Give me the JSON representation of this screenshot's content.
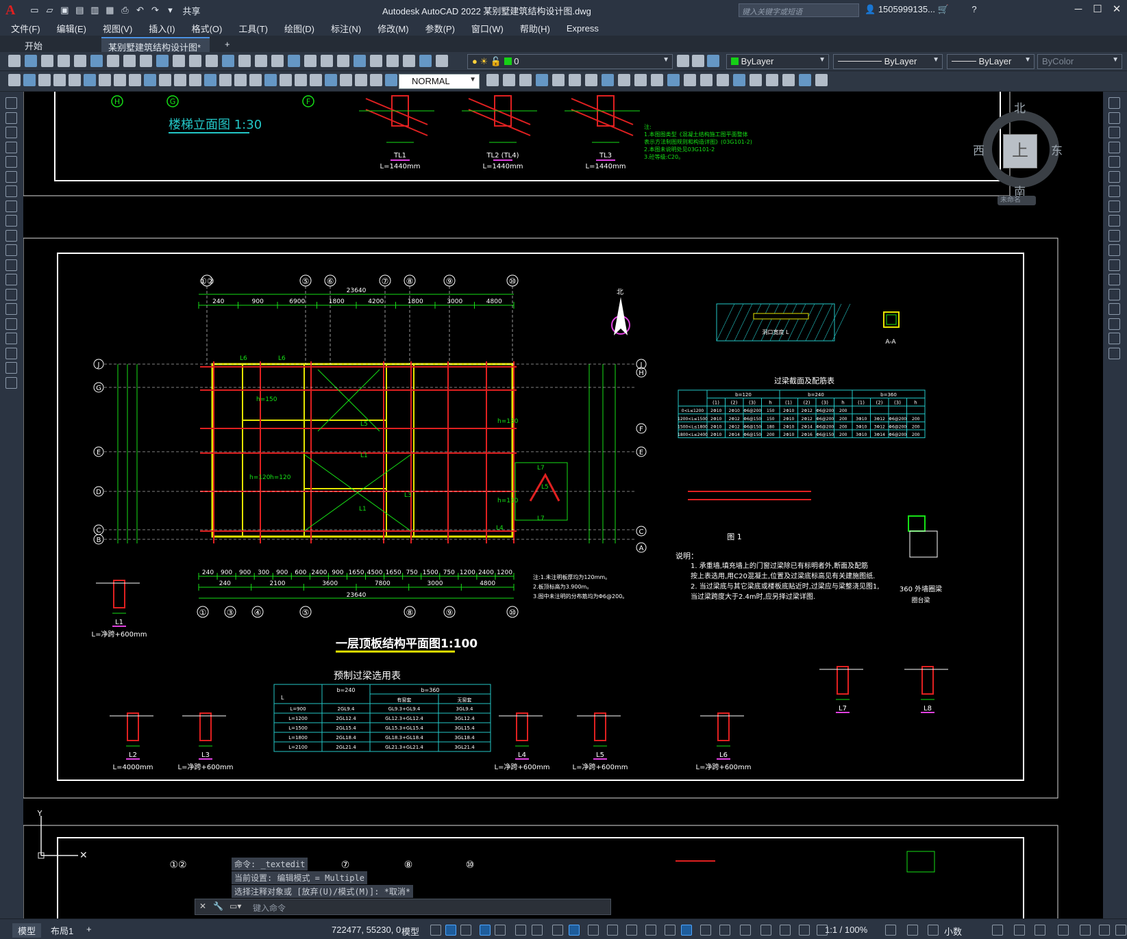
{
  "app": {
    "logo": "A",
    "title": "Autodesk AutoCAD 2022    某别墅建筑结构设计图.dwg",
    "share": "共享",
    "search_placeholder": "键入关键字或短语",
    "user": "1505999135...",
    "help": "?"
  },
  "menu": [
    "文件(F)",
    "编辑(E)",
    "视图(V)",
    "插入(I)",
    "格式(O)",
    "工具(T)",
    "绘图(D)",
    "标注(N)",
    "修改(M)",
    "参数(P)",
    "窗口(W)",
    "帮助(H)",
    "Express"
  ],
  "tabs": {
    "start": "开始",
    "doc": "某别墅建筑结构设计图*",
    "close": "×",
    "add": "+"
  },
  "toolbar": {
    "layer_value": "0",
    "color_value": "ByLayer",
    "linetype_value": "ByLayer",
    "lineweight_value": "ByLayer",
    "plotstyle_value": "ByColor",
    "textstyle_value": "NORMAL"
  },
  "viewcube": {
    "north": "北",
    "south": "南",
    "east": "东",
    "west": "西",
    "top": "上",
    "ucs": "未命名"
  },
  "drawing": {
    "title_main": "一层顶板结构平面图1:100",
    "title_stair": "楼梯立面图  1:30",
    "table_lintel_title": "预制过梁选用表",
    "table_section_title": "过梁截面及配筋表",
    "notes_heading": "说明：",
    "notes": [
      "1. 承重墙,填充墙上的门窗过梁除已有标明者外,断面及配筋",
      "按上表选用,用C20混凝土,位置及过梁底标高见有关建施图纸.",
      "2. 当过梁底与其它梁底或楼板底贴近时,过梁应与梁整浇见图1,",
      "当过梁跨度大于2.4m时,应另择过梁详图."
    ],
    "notes_small": [
      "注:1.未注明板厚均为120mm。",
      "2.板顶标高为3.900m。",
      "3.图中未注明的分布筋均为Φ6@200。"
    ],
    "stair_notes": [
      "注:",
      "1.本图图类型《混凝土结构施工图平面整体",
      "表示方法制图规则和构造详图》(03G101-2)",
      "2.本图未说明处见03G101-2",
      "3.砼等级:C20。"
    ],
    "dims_top1": [
      "240",
      "900",
      "6900",
      "1800",
      "4200",
      "1800",
      "3000",
      "4800"
    ],
    "dims_total": "23640",
    "dims_bot1": [
      "240",
      "900",
      "900",
      "300",
      "900",
      "600",
      "2400",
      "900",
      "1650",
      "4500",
      "1650",
      "750",
      "1500",
      "750",
      "1200",
      "2400",
      "1200"
    ],
    "dims_bot2": [
      "240",
      "2100",
      "3600",
      "7800",
      "3000",
      "4800"
    ],
    "grid_top": [
      "①②",
      "⑤",
      "⑥",
      "⑦",
      "⑧",
      "⑨",
      "⑩"
    ],
    "grid_bot": [
      "①",
      "③",
      "④",
      "⑤",
      "⑧",
      "⑨",
      "⑩"
    ],
    "grid_left": [
      "J",
      "G",
      "E",
      "D",
      "C",
      "B"
    ],
    "grid_right": [
      "J",
      "H",
      "F",
      "E",
      "C",
      "A"
    ],
    "beam_labels": [
      "TL1",
      "TL2 (TL4)",
      "TL3",
      "L1",
      "L2",
      "L3",
      "L4",
      "L5",
      "L6",
      "L7",
      "L8"
    ],
    "beam_lengths": [
      "L=1440mm",
      "L=1440mm",
      "L=1440mm",
      "L=净跨+600mm",
      "L=4000mm",
      "L=净跨+600mm",
      "L=净跨+600mm",
      "L=净跨+600mm",
      "L=净跨+600mm"
    ],
    "lintel_table": {
      "headers": [
        "L",
        "b=240",
        "b=360"
      ],
      "subheaders": [
        "",
        "",
        "有窗套",
        "无窗套"
      ],
      "rows": [
        [
          "L=900",
          "2GL9.4",
          "GL9.3+GL9.4",
          "3GL9.4"
        ],
        [
          "L=1200",
          "2GL12.4",
          "GL12.3+GL12.4",
          "3GL12.4"
        ],
        [
          "L=1500",
          "2GL15.4",
          "GL15.3+GL15.4",
          "3GL15.4"
        ],
        [
          "L=1800",
          "2GL18.4",
          "GL18.3+GL18.4",
          "3GL18.4"
        ],
        [
          "L=2100",
          "2GL21.4",
          "GL21.3+GL21.4",
          "3GL21.4"
        ]
      ]
    },
    "section_table": {
      "groups": [
        "b=120",
        "b=240",
        "b=360"
      ],
      "cols": [
        "(1)",
        "(2)",
        "(3)",
        "h"
      ],
      "rows": [
        [
          "0<L≤1200",
          "2Φ10",
          "2Φ10",
          "Φ6@200",
          "150",
          "2Φ10",
          "2Φ12",
          "Φ6@200",
          "200",
          "",
          "",
          "",
          ""
        ],
        [
          "1200<L≤1500",
          "2Φ10",
          "2Φ12",
          "Φ6@150",
          "150",
          "2Φ10",
          "2Φ12",
          "Φ6@200",
          "200",
          "3Φ10",
          "3Φ12",
          "Φ6@200",
          "200"
        ],
        [
          "1500<L≤1800",
          "2Φ10",
          "2Φ12",
          "Φ6@150",
          "180",
          "2Φ10",
          "2Φ14",
          "Φ6@200",
          "200",
          "3Φ10",
          "3Φ12",
          "Φ6@200",
          "200"
        ],
        [
          "1800<L≤2400",
          "2Φ10",
          "2Φ14",
          "Φ6@150",
          "200",
          "2Φ10",
          "2Φ16",
          "Φ6@150",
          "200",
          "3Φ10",
          "3Φ14",
          "Φ6@200",
          "200"
        ]
      ]
    },
    "detail_labels": {
      "aa": "A-A",
      "fig1": "图 1",
      "ring_beam": "360 外墙圈梁",
      "balcony": "圈台梁",
      "h150": "h=150",
      "h120": "h=120",
      "h130": "h=130",
      "hole": "洞口宽度 L"
    }
  },
  "cmd": {
    "history": [
      "命令: _textedit",
      "当前设置: 编辑模式 = Multiple",
      "选择注释对象或 [放弃(U)/模式(M)]: *取消*"
    ],
    "placeholder": "键入命令"
  },
  "status": {
    "model_tab": "模型",
    "layout_tab": "布局1",
    "add": "+",
    "coords": "722477, 55230, 0",
    "space": "模型",
    "scale": "1:1 / 100%",
    "units": "小数"
  }
}
